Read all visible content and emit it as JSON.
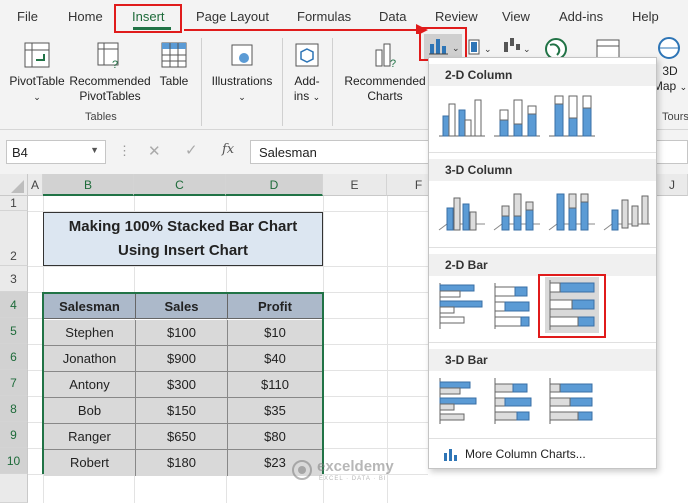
{
  "ribbon_tabs": [
    {
      "label": "File"
    },
    {
      "label": "Home"
    },
    {
      "label": "Insert"
    },
    {
      "label": "Page Layout"
    },
    {
      "label": "Formulas"
    },
    {
      "label": "Data"
    },
    {
      "label": "Review"
    },
    {
      "label": "View"
    },
    {
      "label": "Add-ins"
    },
    {
      "label": "Help"
    }
  ],
  "ribbon": {
    "pivottable": "PivotTable",
    "recommended_pivottables_1": "Recommended",
    "recommended_pivottables_2": "PivotTables",
    "table": "Table",
    "tables_group": "Tables",
    "illustrations": "Illustrations",
    "addins_1": "Add-",
    "addins_2": "ins",
    "recommended_charts_1": "Recommended",
    "recommended_charts_2": "Charts",
    "map3d_1": "3D",
    "map3d_2": "Map",
    "tours_group": "Tours"
  },
  "formula_bar": {
    "name_box": "B4",
    "formula": "Salesman",
    "fx": "fx"
  },
  "columns": [
    "A",
    "B",
    "C",
    "D",
    "E",
    "F",
    "J"
  ],
  "rows": [
    "1",
    "2",
    "3",
    "4",
    "5",
    "6",
    "7",
    "8",
    "9",
    "10"
  ],
  "sheet": {
    "title_line1": "Making 100% Stacked Bar Chart",
    "title_line2": "Using Insert Chart",
    "headers": [
      "Salesman",
      "Sales",
      "Profit"
    ],
    "data": [
      [
        "Stephen",
        "$100",
        "$10"
      ],
      [
        "Jonathon",
        "$900",
        "$40"
      ],
      [
        "Antony",
        "$300",
        "$110"
      ],
      [
        "Bob",
        "$150",
        "$35"
      ],
      [
        "Ranger",
        "$650",
        "$80"
      ],
      [
        "Robert",
        "$180",
        "$23"
      ]
    ]
  },
  "chart_menu": {
    "sections": [
      "2-D Column",
      "3-D Column",
      "2-D Bar",
      "3-D Bar"
    ],
    "more": "More Column Charts..."
  },
  "watermark": {
    "name": "exceldemy",
    "tagline": "EXCEL · DATA · BI"
  },
  "colors": {
    "accent_red": "#e01b1b",
    "excel_green": "#217346",
    "chart_blue": "#5b9bd5",
    "title_fill": "#dce6f1",
    "header_fill": "#acb9ca",
    "cell_fill": "#d9d9d9"
  }
}
